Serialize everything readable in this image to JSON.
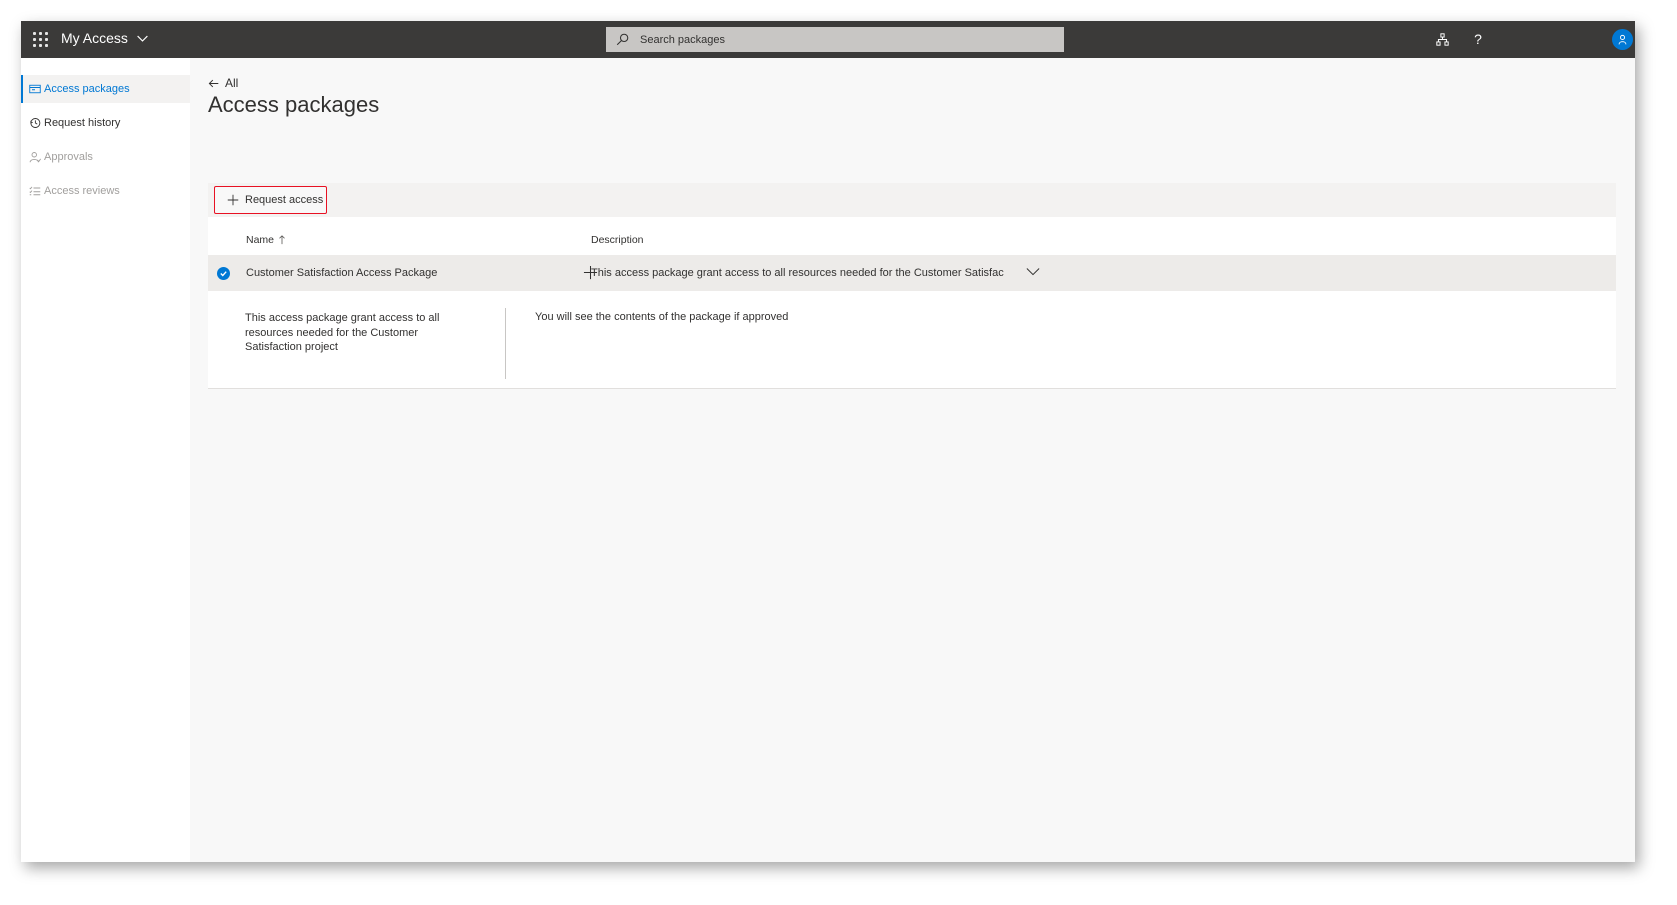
{
  "app": {
    "title": "My Access"
  },
  "search": {
    "placeholder": "Search packages"
  },
  "header_icons": [
    "org-chart-icon",
    "help-icon",
    "avatar-icon"
  ],
  "header": {
    "help_glyph": "?"
  },
  "sidebar": {
    "items": [
      {
        "label": "Access packages",
        "icon": "package-icon",
        "state": "active"
      },
      {
        "label": "Request history",
        "icon": "history-icon",
        "state": "normal"
      },
      {
        "label": "Approvals",
        "icon": "person-icon",
        "state": "disabled"
      },
      {
        "label": "Access reviews",
        "icon": "list-check-icon",
        "state": "disabled"
      }
    ]
  },
  "main": {
    "back_label": "All",
    "title": "Access packages",
    "commandbar": {
      "request_access_label": "Request access"
    },
    "list": {
      "columns": [
        "Name",
        "Description"
      ],
      "rows": [
        {
          "name": "Customer Satisfaction Access Package",
          "description": "This access package grant access to all resources needed for the Customer Satisfac",
          "selected": true
        }
      ],
      "detail": {
        "description": "This access package grant access to all resources needed for the Customer Satisfaction project",
        "contents_note": "You will see the contents of the package if approved"
      }
    }
  },
  "colors": {
    "topbar": "#3b3a39",
    "accent": "#0078d4",
    "highlight_border": "#e81123"
  }
}
